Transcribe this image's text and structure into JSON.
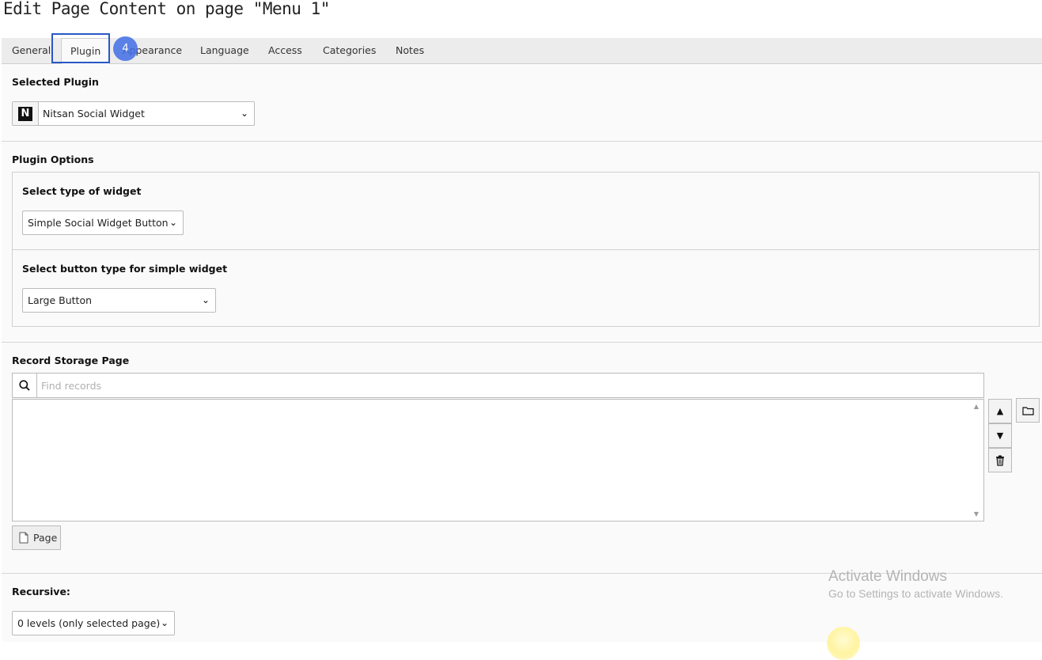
{
  "header": {
    "title": "Edit Page Content on page \"Menu 1\""
  },
  "tabs": [
    {
      "label": "General"
    },
    {
      "label": "Plugin",
      "active": true
    },
    {
      "label": "Appearance"
    },
    {
      "label": "Language"
    },
    {
      "label": "Access"
    },
    {
      "label": "Categories"
    },
    {
      "label": "Notes"
    }
  ],
  "step_badge": "4",
  "selected_plugin": {
    "label": "Selected Plugin",
    "icon": "nitsan-n-icon",
    "value": "Nitsan Social Widget"
  },
  "plugin_options": {
    "label": "Plugin Options",
    "widget_type": {
      "label": "Select type of widget",
      "value": "Simple Social Widget Button"
    },
    "button_type": {
      "label": "Select button type for simple widget",
      "value": "Large Button"
    }
  },
  "record_storage": {
    "label": "Record Storage Page",
    "search_placeholder": "Find records",
    "page_button_label": "Page"
  },
  "recursive": {
    "label": "Recursive:",
    "value": "0 levels (only selected page)"
  },
  "watermark": {
    "title": "Activate Windows",
    "subtitle": "Go to Settings to activate Windows."
  }
}
